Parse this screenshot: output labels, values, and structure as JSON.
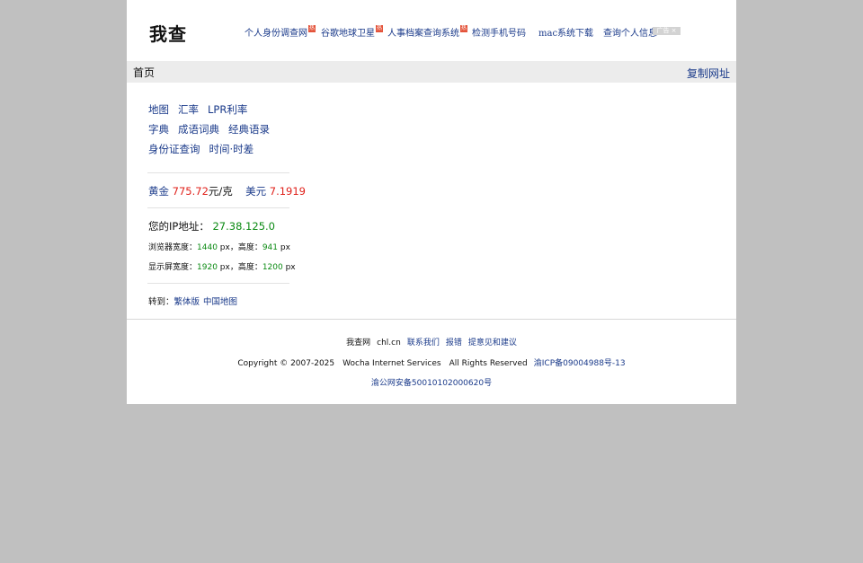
{
  "header": {
    "logo": "我查",
    "ad_links": [
      {
        "label": "个人身份调查网",
        "hot": "热"
      },
      {
        "label": "谷歌地球卫星",
        "hot": "热"
      },
      {
        "label": "人事档案查询系统",
        "hot": "热"
      },
      {
        "label": "检测手机号码",
        "hot": ""
      },
      {
        "label": "mac系统下载",
        "hot": ""
      },
      {
        "label": "查询个人信息",
        "hot": ""
      }
    ],
    "ad_tag": "广告 ×"
  },
  "bar": {
    "home": "首页",
    "copy_url": "复制网址"
  },
  "links": {
    "row1": [
      "地图",
      "汇率",
      "LPR利率"
    ],
    "row2": [
      "字典",
      "成语词典",
      "经典语录"
    ],
    "row3": [
      "身份证查询",
      "时间·时差"
    ]
  },
  "prices": {
    "gold_label": "黄金",
    "gold_value": "775.72",
    "gold_unit": "元/克",
    "usd_label": "美元",
    "usd_value": "7.1919"
  },
  "ip": {
    "label": "您的IP地址：",
    "value": "27.38.125.0"
  },
  "browser": {
    "width_label": "浏览器宽度：",
    "width_value": "1440",
    "px1": " px，高度：",
    "height_value": "941",
    "px2": " px"
  },
  "screen": {
    "width_label": "显示屏宽度：",
    "width_value": "1920",
    "px1": " px，高度：",
    "height_value": "1200",
    "px2": " px"
  },
  "goto": {
    "label": "转到：",
    "links": [
      "繁体版",
      "中国地图"
    ]
  },
  "footer": {
    "site_name": "我查网",
    "domain": "chl.cn",
    "links": [
      "联系我们",
      "报错",
      "提意见和建议"
    ],
    "copyright": "Copyright © 2007-2025　Wocha Internet Services　All Rights Reserved",
    "icp": "渝ICP备09004988号-13",
    "police": "渝公网安备50010102000620号"
  },
  "colors": {
    "link": "#1a3a8a",
    "price": "#e0201a",
    "value": "#0a8a12",
    "bar_bg": "#ececec",
    "outer_bg": "#c0c0c0"
  }
}
